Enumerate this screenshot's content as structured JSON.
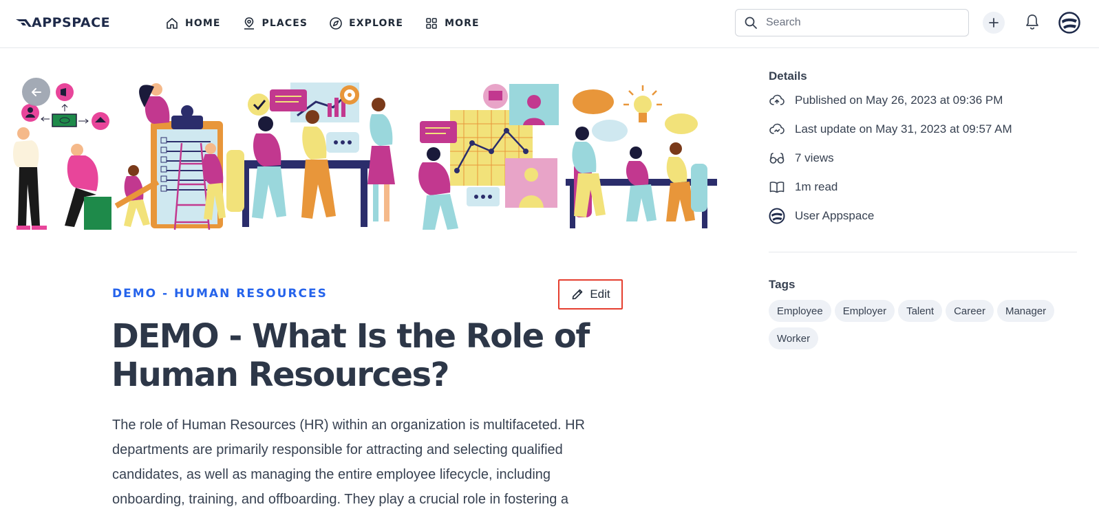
{
  "app": {
    "logo_text": "APPSPACE"
  },
  "nav": [
    {
      "label": "HOME",
      "icon": "home-icon"
    },
    {
      "label": "PLACES",
      "icon": "places-icon"
    },
    {
      "label": "EXPLORE",
      "icon": "compass-icon"
    },
    {
      "label": "MORE",
      "icon": "grid-icon"
    }
  ],
  "search": {
    "placeholder": "Search",
    "value": ""
  },
  "article": {
    "category": "DEMO - HUMAN RESOURCES",
    "edit_label": "Edit",
    "title": "DEMO - What Is the Role of Human Resources?",
    "body": "The role of Human Resources (HR) within an organization is multifaceted. HR departments are primarily responsible for attracting and selecting qualified candidates, as well as managing the entire employee lifecycle, including onboarding, training, and offboarding. They play a crucial role in fostering a"
  },
  "details": {
    "heading": "Details",
    "published": "Published on May 26, 2023 at 09:36 PM",
    "updated": "Last update on May 31, 2023 at 09:57 AM",
    "views": "7 views",
    "read_time": "1m read",
    "author": "User Appspace"
  },
  "tags": {
    "heading": "Tags",
    "items": [
      "Employee",
      "Employer",
      "Talent",
      "Career",
      "Manager",
      "Worker"
    ]
  },
  "colors": {
    "accent": "#2563eb",
    "title": "#2d3748",
    "highlight_border": "#e53e2e",
    "tag_bg": "#eef1f6",
    "illustration_magenta": "#c2388f",
    "illustration_navy": "#2b2d6b",
    "illustration_teal": "#9ad7dc",
    "illustration_orange": "#e8963a",
    "illustration_yellow": "#f2e27a"
  }
}
